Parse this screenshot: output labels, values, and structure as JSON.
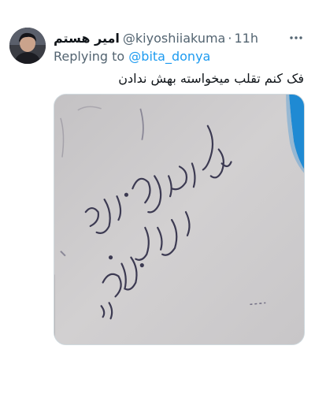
{
  "tweet": {
    "author": {
      "display_name": "امیر هستم",
      "handle": "@kiyoshiiakuma",
      "time_separator": "·",
      "time": "11h",
      "avatar_icon": "user-avatar"
    },
    "more_icon": "more-horizontal-icon",
    "replying_to": {
      "prefix": "Replying to",
      "mention": "@bita_donya"
    },
    "text": "فک کنم تقلب میخواسته بهش ندادن",
    "media": {
      "description_icon": "photo-of-handwriting",
      "handwriting_lines": [
        "ولم",
        "ازاین وقتی",
        "ایادت داشتم :)"
      ]
    }
  },
  "colors": {
    "text_primary": "#0f1419",
    "text_secondary": "#536471",
    "link": "#1d9bf0",
    "paper": "#cfcdce",
    "ink": "#3c3a52",
    "accent_blue": "#1f8ad3"
  }
}
